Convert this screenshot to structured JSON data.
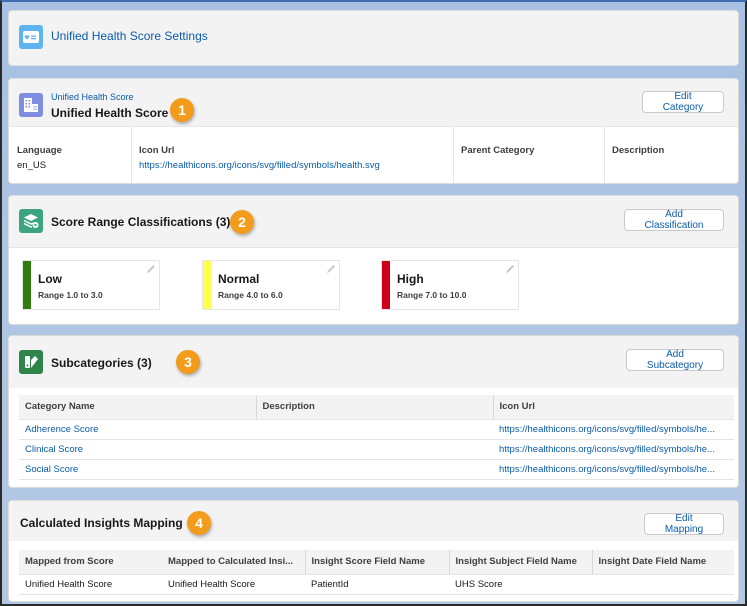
{
  "app": {
    "title": "Unified Health Score Settings",
    "title_icon": "health-card-icon"
  },
  "category": {
    "breadcrumb": "Unified Health Score",
    "title": "Unified Health Score",
    "icon": "building-icon",
    "badge": "1",
    "edit_button": "Edit Category",
    "fields": [
      {
        "label": "Language",
        "value": "en_US"
      },
      {
        "label": "Icon Url",
        "value": "https://healthicons.org/icons/svg/filled/symbols/health.svg"
      },
      {
        "label": "Parent Category",
        "value": ""
      },
      {
        "label": "Description",
        "value": ""
      }
    ]
  },
  "classifications": {
    "title": "Score Range Classifications (3)",
    "icon": "stacked-layers-icon",
    "badge": "2",
    "add_button": "Add Classification",
    "items": [
      {
        "name": "Low",
        "range": "Range 1.0 to 3.0",
        "color": "#2e844a"
      },
      {
        "name": "Normal",
        "range": "Range 4.0 to 6.0",
        "color": "#ffff4d"
      },
      {
        "name": "High",
        "range": "Range 7.0 to 10.0",
        "color": "#d0021b"
      }
    ]
  },
  "subcategories": {
    "title": "Subcategories (3)",
    "icon": "swatch-icon",
    "badge": "3",
    "add_button": "Add Subcategory",
    "columns": [
      "Category Name",
      "Description",
      "Icon Url"
    ],
    "rows": [
      {
        "name": "Adherence Score",
        "description": "",
        "icon_url": "https://healthicons.org/icons/svg/filled/symbols/he..."
      },
      {
        "name": "Clinical Score",
        "description": "",
        "icon_url": "https://healthicons.org/icons/svg/filled/symbols/he..."
      },
      {
        "name": "Social Score",
        "description": "",
        "icon_url": "https://healthicons.org/icons/svg/filled/symbols/he..."
      }
    ]
  },
  "mapping": {
    "title": "Calculated Insights Mapping",
    "badge": "4",
    "edit_button": "Edit Mapping",
    "columns": [
      "Mapped from Score",
      "Mapped to Calculated Insi...",
      "Insight Score Field Name",
      "Insight Subject Field Name",
      "Insight Date Field Name"
    ],
    "rows": [
      [
        "Unified Health Score",
        "Unified Health Score",
        "PatientId",
        "UHS Score",
        ""
      ]
    ]
  },
  "colors": {
    "link": "#0b5cab",
    "badge": "#f39b1b",
    "title_icon_bg": "#5eb4ef",
    "category_icon_bg": "#7f8de1",
    "classification_icon_bg": "#3ba57f",
    "subcategory_icon_bg": "#2e844a"
  }
}
